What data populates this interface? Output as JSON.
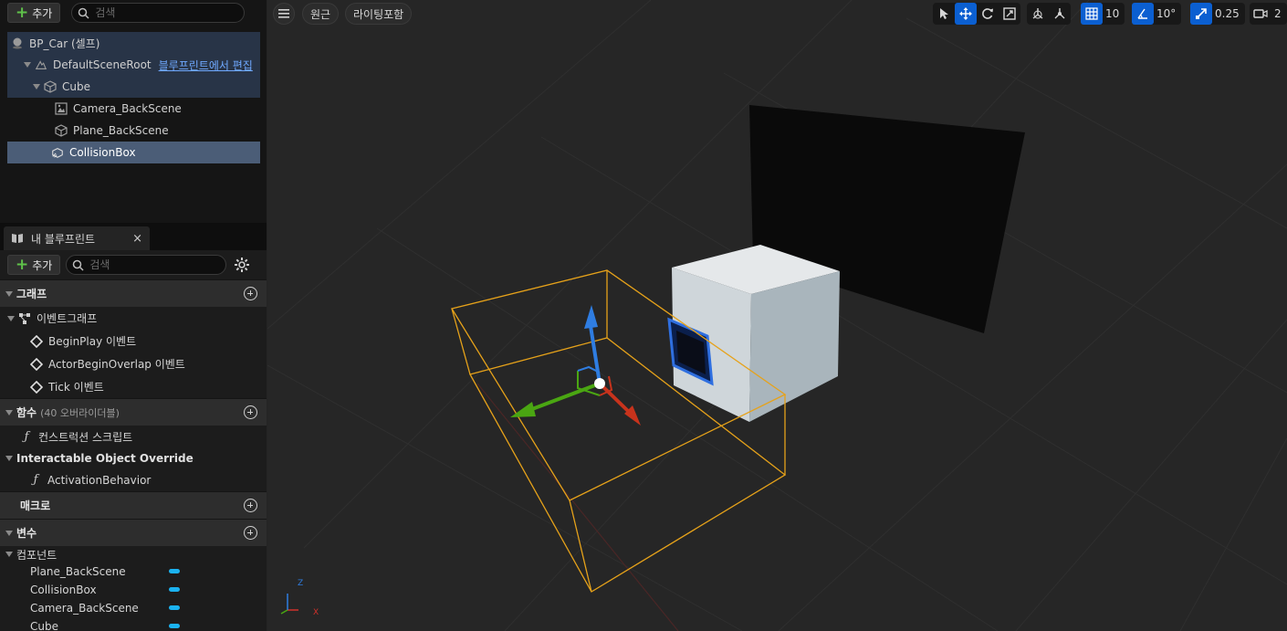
{
  "components_panel": {
    "add_label": "추가",
    "search_placeholder": "검색",
    "tree": [
      {
        "label": "BP_Car (셀프)"
      },
      {
        "label": "DefaultSceneRoot",
        "link": "블루프린트에서 편집"
      },
      {
        "label": "Cube"
      },
      {
        "label": "Camera_BackScene"
      },
      {
        "label": "Plane_BackScene"
      },
      {
        "label": "CollisionBox"
      }
    ]
  },
  "my_blueprint": {
    "tab_label": "내 블루프린트",
    "close_glyph": "×",
    "add_label": "추가",
    "search_placeholder": "검색",
    "sections": {
      "graph": {
        "label": "그래프",
        "event_graph": "이벤트그래프",
        "events": [
          "BeginPlay 이벤트",
          "ActorBeginOverlap 이벤트",
          "Tick 이벤트"
        ]
      },
      "functions": {
        "label": "함수",
        "sub": "(40 오버라이더블)",
        "items": [
          "컨스트럭션 스크립트"
        ],
        "category": "Interactable Object Override",
        "category_items": [
          "ActivationBehavior"
        ]
      },
      "macros": {
        "label": "매크로"
      },
      "variables": {
        "label": "변수",
        "category": "컴포넌트",
        "items": [
          "Plane_BackScene",
          "CollisionBox",
          "Camera_BackScene",
          "Cube"
        ]
      }
    }
  },
  "viewport": {
    "perspective_label": "원근",
    "lighting_label": "라이팅포함",
    "grid_snap": "10",
    "rotation_snap": "10°",
    "scale_snap": "0.25",
    "camera_speed": "2",
    "axis_x": "X",
    "axis_z": "Z"
  },
  "colors": {
    "selection": "#4b5d77",
    "accent": "#0b5fd1",
    "link": "#6fa9ff",
    "var_pill": "#1bb2f0",
    "collision_box": "#e6a21a"
  }
}
